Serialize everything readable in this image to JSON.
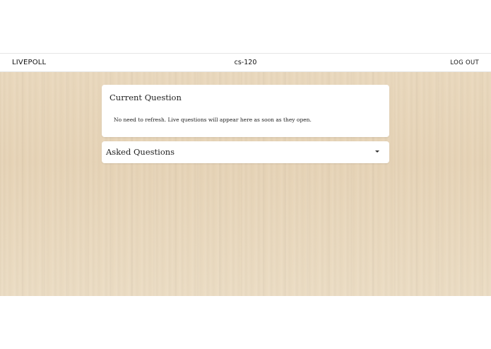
{
  "navbar": {
    "brand": "LIVEPOLL",
    "course": "cs-120",
    "logout": "LOG OUT"
  },
  "current_question": {
    "title": "Current Question",
    "message": "No need to refresh. Live questions will appear here as soon as they open."
  },
  "asked_questions": {
    "title": "Asked Questions",
    "icon": "caret-down-icon"
  },
  "colors": {
    "background_wood": "#e8d6b9",
    "card": "#ffffff",
    "text": "#222222"
  }
}
